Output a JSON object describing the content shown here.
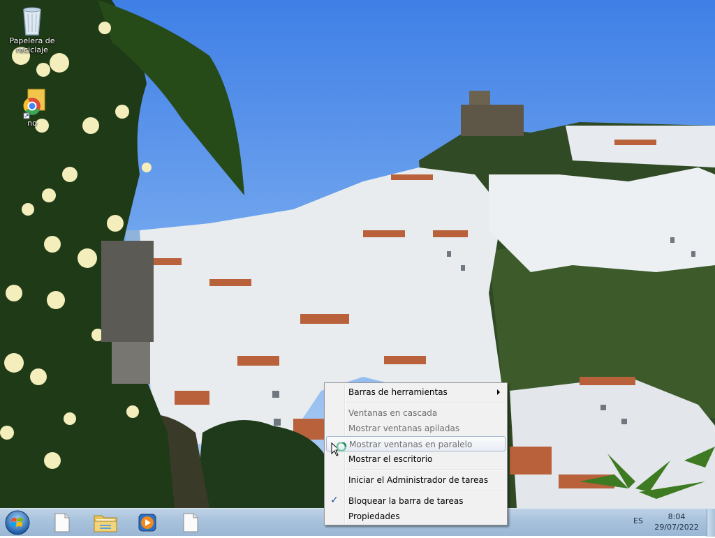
{
  "desktop": {
    "icons": [
      {
        "name": "recycle-bin",
        "label": "Papelera de reciclaje"
      },
      {
        "name": "chrome-shortcut",
        "label": "no"
      }
    ]
  },
  "context_menu": {
    "items": [
      {
        "label": "Barras de herramientas",
        "disabled": false,
        "submenu": true
      },
      {
        "label": "Ventanas en cascada",
        "disabled": true
      },
      {
        "label": "Mostrar ventanas apiladas",
        "disabled": true
      },
      {
        "label": "Mostrar ventanas en paralelo",
        "disabled": true,
        "highlighted": true
      },
      {
        "label": "Mostrar el escritorio",
        "disabled": false
      },
      {
        "label": "Iniciar el Administrador de tareas",
        "disabled": false
      },
      {
        "label": "Bloquear la barra de tareas",
        "disabled": false,
        "checked": true
      },
      {
        "label": "Propiedades",
        "disabled": false
      }
    ],
    "check_mark": "✓"
  },
  "taskbar": {
    "pinned": [
      "document-icon",
      "folder-icon",
      "media-player-icon",
      "document-icon"
    ],
    "tray": {
      "language": "ES",
      "time": "8:04",
      "date": "29/07/2022"
    }
  },
  "colors": {
    "taskbar": "#a8c2dc",
    "menu_bg": "#f1f1f1",
    "menu_disabled_text": "#6d6d6d",
    "sky": "#4a86e8"
  }
}
